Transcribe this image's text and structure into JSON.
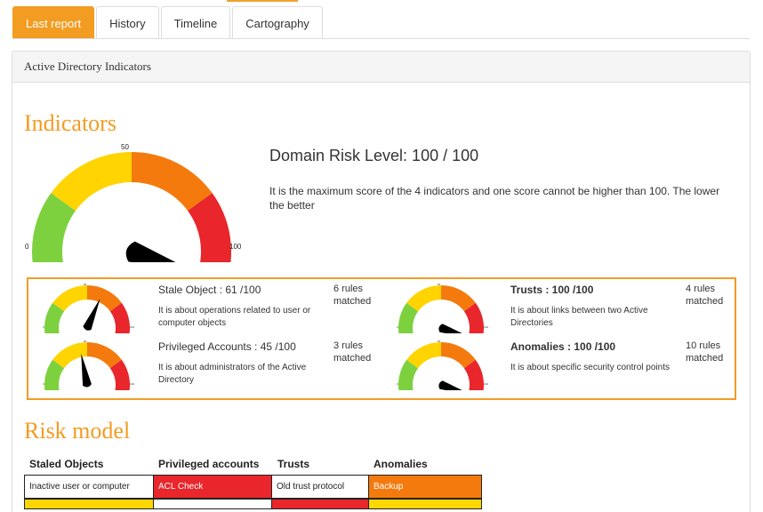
{
  "tabs": [
    {
      "label": "Last report",
      "active": true
    },
    {
      "label": "History",
      "active": false
    },
    {
      "label": "Timeline",
      "active": false
    },
    {
      "label": "Cartography",
      "active": false
    }
  ],
  "panel": {
    "title": "Active Directory Indicators"
  },
  "indicators_heading": "Indicators",
  "domain_gauge": {
    "min_label": "0",
    "mid_label": "50",
    "max_label": "100",
    "value": 100
  },
  "domain_risk": {
    "level": "Domain Risk Level: 100 / 100",
    "description": "It is the maximum score of the 4 indicators and one score cannot be higher than 100. The lower the better"
  },
  "indicators": [
    {
      "title": "Stale Object : 61 /100",
      "value": 61,
      "bold": false,
      "description": "It is about operations related to user or computer objects",
      "rules": "6 rules matched"
    },
    {
      "title": "Privileged Accounts : 45 /100",
      "value": 45,
      "bold": false,
      "description": "It is about administrators of the Active Directory",
      "rules": "3 rules matched"
    },
    {
      "title": "Trusts : 100 /100",
      "value": 100,
      "bold": true,
      "description": "It is about links between two Active Directories",
      "rules": "4 rules matched"
    },
    {
      "title": "Anomalies : 100 /100",
      "value": 100,
      "bold": true,
      "description": "It is about specific security control points",
      "rules": "10 rules matched"
    }
  ],
  "mini_gauge_labels": {
    "min": "0",
    "mid": "50",
    "max": "100"
  },
  "risk_model": {
    "heading": "Risk model",
    "columns": [
      "Staled Objects",
      "Privileged accounts",
      "Trusts",
      "Anomalies"
    ],
    "row1": [
      {
        "text": "Inactive user or computer",
        "color": "#ffffff",
        "text_color": "#222222"
      },
      {
        "text": "ACL Check",
        "color": "#e8262b",
        "text_color": "#ffffff"
      },
      {
        "text": "Old trust protocol",
        "color": "#ffffff",
        "text_color": "#222222"
      },
      {
        "text": "Backup",
        "color": "#f47a0e",
        "text_color": "#ffffff"
      }
    ],
    "row2_colors": [
      "#ffd700",
      "#ffffff",
      "#e8262b",
      "#ffd700"
    ]
  },
  "colors": {
    "accent": "#f39c22",
    "green": "#7dd13e",
    "yellow": "#ffd400",
    "orange": "#f47a0e",
    "red": "#e8262b"
  }
}
